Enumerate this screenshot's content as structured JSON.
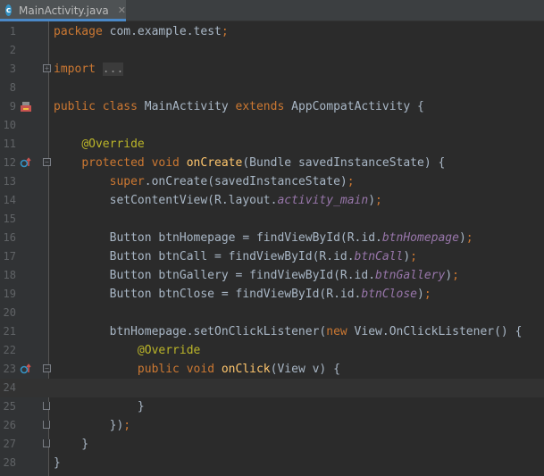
{
  "tab": {
    "title": "MainActivity.java",
    "icon_letter": "c",
    "close": "✕"
  },
  "lines": [
    {
      "n": "1",
      "parts": [
        [
          "kw",
          "package"
        ],
        [
          "p",
          " com.example.test"
        ],
        [
          "kw",
          ";"
        ]
      ]
    },
    {
      "n": "2",
      "parts": []
    },
    {
      "n": "3",
      "fold": "plus",
      "parts": [
        [
          "kw",
          "import"
        ],
        [
          "p",
          " "
        ],
        [
          "ph",
          "..."
        ]
      ]
    },
    {
      "n": "8",
      "parts": []
    },
    {
      "n": "9",
      "marker": "android",
      "parts": [
        [
          "kw",
          "public class"
        ],
        [
          "p",
          " MainActivity "
        ],
        [
          "kw",
          "extends"
        ],
        [
          "p",
          " AppCompatActivity {"
        ]
      ]
    },
    {
      "n": "10",
      "parts": []
    },
    {
      "n": "11",
      "parts": [
        [
          "p",
          "    "
        ],
        [
          "ann",
          "@Override"
        ]
      ]
    },
    {
      "n": "12",
      "marker": "override",
      "fold": "minus",
      "parts": [
        [
          "p",
          "    "
        ],
        [
          "kw",
          "protected void"
        ],
        [
          "p",
          " "
        ],
        [
          "fn",
          "onCreate"
        ],
        [
          "p",
          "(Bundle savedInstanceState) {"
        ]
      ]
    },
    {
      "n": "13",
      "parts": [
        [
          "p",
          "        "
        ],
        [
          "kw",
          "super"
        ],
        [
          "p",
          ".onCreate(savedInstanceState)"
        ],
        [
          "kw",
          ";"
        ]
      ]
    },
    {
      "n": "14",
      "parts": [
        [
          "p",
          "        setContentView(R.layout."
        ],
        [
          "fld",
          "activity_main"
        ],
        [
          "p",
          ")"
        ],
        [
          "kw",
          ";"
        ]
      ]
    },
    {
      "n": "15",
      "parts": []
    },
    {
      "n": "16",
      "parts": [
        [
          "p",
          "        Button btnHomepage = findViewById(R.id."
        ],
        [
          "fld",
          "btnHomepage"
        ],
        [
          "p",
          ")"
        ],
        [
          "kw",
          ";"
        ]
      ]
    },
    {
      "n": "17",
      "parts": [
        [
          "p",
          "        Button btnCall = findViewById(R.id."
        ],
        [
          "fld",
          "btnCall"
        ],
        [
          "p",
          ")"
        ],
        [
          "kw",
          ";"
        ]
      ]
    },
    {
      "n": "18",
      "parts": [
        [
          "p",
          "        Button btnGallery = findViewById(R.id."
        ],
        [
          "fld",
          "btnGallery"
        ],
        [
          "p",
          ")"
        ],
        [
          "kw",
          ";"
        ]
      ]
    },
    {
      "n": "19",
      "parts": [
        [
          "p",
          "        Button btnClose = findViewById(R.id."
        ],
        [
          "fld",
          "btnClose"
        ],
        [
          "p",
          ")"
        ],
        [
          "kw",
          ";"
        ]
      ]
    },
    {
      "n": "20",
      "parts": []
    },
    {
      "n": "21",
      "parts": [
        [
          "p",
          "        btnHomepage.setOnClickListener("
        ],
        [
          "kw",
          "new"
        ],
        [
          "p",
          " View.OnClickListener() {"
        ]
      ]
    },
    {
      "n": "22",
      "parts": [
        [
          "p",
          "            "
        ],
        [
          "ann",
          "@Override"
        ]
      ]
    },
    {
      "n": "23",
      "marker": "override",
      "fold": "minus",
      "parts": [
        [
          "p",
          "            "
        ],
        [
          "kw",
          "public void"
        ],
        [
          "p",
          " "
        ],
        [
          "fn",
          "onClick"
        ],
        [
          "p",
          "(View v) {"
        ]
      ]
    },
    {
      "n": "24",
      "current": true,
      "parts": []
    },
    {
      "n": "25",
      "fold": "end",
      "parts": [
        [
          "p",
          "            }"
        ]
      ]
    },
    {
      "n": "26",
      "fold": "end",
      "parts": [
        [
          "p",
          "        })"
        ],
        [
          "kw",
          ";"
        ]
      ]
    },
    {
      "n": "27",
      "fold": "end",
      "parts": [
        [
          "p",
          "    }"
        ]
      ]
    },
    {
      "n": "28",
      "parts": [
        [
          "p",
          "}"
        ]
      ]
    }
  ]
}
